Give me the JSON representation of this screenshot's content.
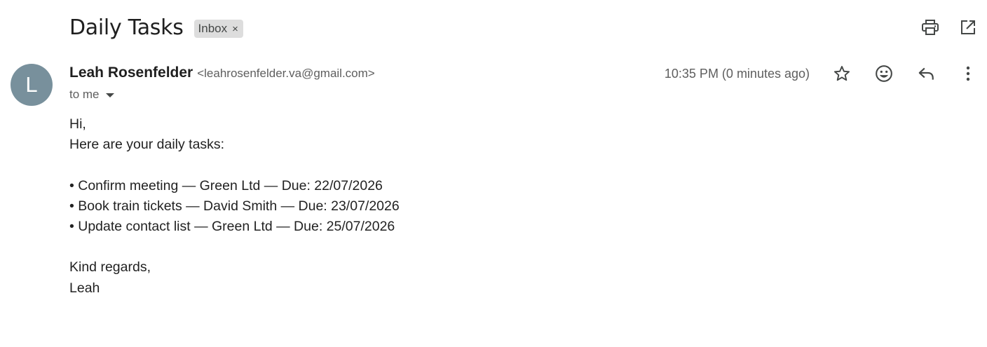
{
  "email": {
    "subject": "Daily Tasks",
    "label": "Inbox",
    "label_close": "×",
    "sender": {
      "name": "Leah Rosenfelder",
      "email": "<leahrosenfelder.va@gmail.com>",
      "avatar_initial": "L",
      "avatar_color": "#78909c"
    },
    "recipient": "to me",
    "timestamp": "10:35 PM (0 minutes ago)",
    "body": {
      "greeting": "Hi,",
      "intro": "Here are your daily tasks:",
      "tasks": [
        "• Confirm meeting — Green Ltd — Due: 22/07/2026",
        "• Book train tickets — David Smith — Due: 23/07/2026",
        "• Update contact list — Green Ltd — Due: 25/07/2026"
      ],
      "closing": "Kind regards,",
      "signature": "Leah"
    }
  },
  "icons": {
    "top": [
      "print-icon",
      "open-in-new-window-icon"
    ],
    "message": [
      "star-icon",
      "emoji-reaction-icon",
      "reply-icon",
      "more-options-icon"
    ]
  }
}
